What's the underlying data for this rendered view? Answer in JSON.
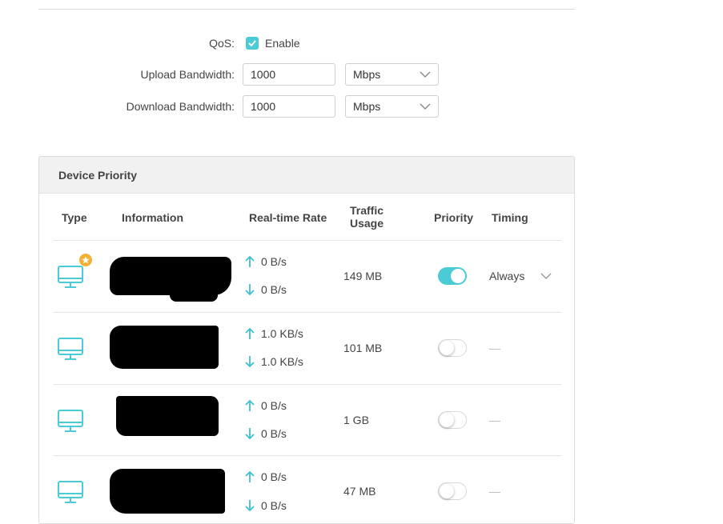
{
  "qos": {
    "label": "QoS:",
    "enabled": true,
    "enable_label": "Enable"
  },
  "upload": {
    "label": "Upload Bandwidth:",
    "value": "1000",
    "unit": "Mbps"
  },
  "download": {
    "label": "Download Bandwidth:",
    "value": "1000",
    "unit": "Mbps"
  },
  "device_priority": {
    "title": "Device Priority",
    "columns": {
      "type": "Type",
      "information": "Information",
      "rate": "Real-time Rate",
      "usage_line1": "Traffic",
      "usage_line2": "Usage",
      "priority": "Priority",
      "timing": "Timing"
    },
    "rows": [
      {
        "icon": "desktop-monitor-icon",
        "starred": true,
        "up": "0 B/s",
        "down": "0 B/s",
        "usage": "149 MB",
        "priority": true,
        "timing": "Always"
      },
      {
        "icon": "desktop-monitor-icon",
        "starred": false,
        "up": "1.0 KB/s",
        "down": "1.0 KB/s",
        "usage": "101 MB",
        "priority": false,
        "timing": "—"
      },
      {
        "icon": "desktop-monitor-icon",
        "starred": false,
        "up": "0 B/s",
        "down": "0 B/s",
        "usage": "1 GB",
        "priority": false,
        "timing": "—"
      },
      {
        "icon": "desktop-monitor-icon",
        "starred": false,
        "up": "0 B/s",
        "down": "0 B/s",
        "usage": "47 MB",
        "priority": false,
        "timing": "—"
      }
    ]
  },
  "colors": {
    "accent": "#4acbd6",
    "star": "#f0b136",
    "arrow": "#3fc0d0"
  }
}
